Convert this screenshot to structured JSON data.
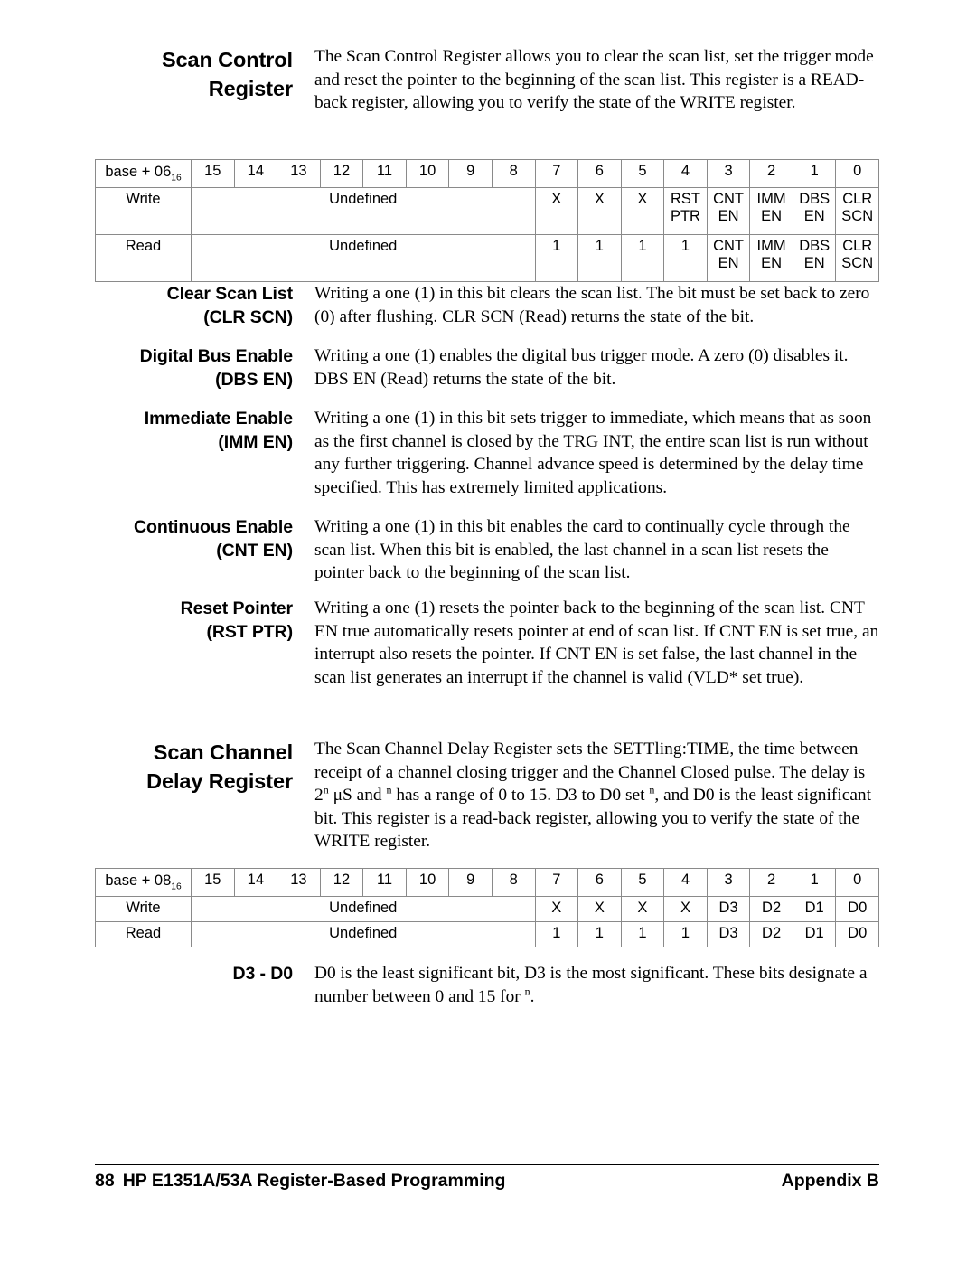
{
  "sections": [
    {
      "id": "scan-control-register",
      "heading_lines": [
        "Scan Control",
        "Register"
      ],
      "body": "The Scan Control Register allows you to clear the scan list, set the trigger mode and reset the pointer to the beginning of the scan list.  This register is a READ-back register, allowing you to verify the state of the WRITE register."
    },
    {
      "id": "clear-scan-list",
      "heading_lines": [
        "Clear Scan List",
        "(CLR SCN)"
      ],
      "body": "Writing a one (1) in this bit clears the scan list.  The bit must be set back to zero (0) after flushing.  CLR SCN (Read) returns the state of the bit."
    },
    {
      "id": "digital-bus-enable",
      "heading_lines": [
        "Digital Bus Enable",
        "(DBS EN)"
      ],
      "body": "Writing a one (1) enables the digital bus trigger mode.  A zero (0) disables it.  DBS EN (Read) returns the state of the bit."
    },
    {
      "id": "immediate-enable",
      "heading_lines": [
        "Immediate Enable",
        "(IMM EN)"
      ],
      "body": "Writing a one (1) in this bit sets trigger to immediate, which means that as soon as the first channel is closed by the TRG INT, the entire scan list is run without any further triggering.  Channel advance speed is determined by the delay time specified.  This has extremely limited applications."
    },
    {
      "id": "continuous-enable",
      "heading_lines": [
        "Continuous Enable",
        "(CNT EN)"
      ],
      "body": "Writing a one (1) in this bit enables the card to continually cycle through the scan list.  When this bit is enabled, the last channel in a scan list resets the pointer back to the beginning of the scan list."
    },
    {
      "id": "reset-pointer",
      "heading_lines": [
        "Reset Pointer",
        "(RST PTR)"
      ],
      "body": "Writing a one (1) resets the pointer back to the beginning of the scan list.  CNT EN true automatically resets pointer at end of scan list.  If CNT EN is set true, an interrupt also resets the pointer.  If CNT EN is set false, the last channel in the scan list generates an interrupt if the channel is valid (VLD* set true)."
    },
    {
      "id": "scan-channel-delay-register",
      "heading_lines": [
        "Scan Channel",
        "Delay Register"
      ],
      "body_html": "The Scan Channel Delay Register sets the SETTling:TIME, the time between receipt of a channel closing trigger and the Channel Closed pulse.  The delay is 2<sup>n</sup> μS and <sup>n</sup> has a range of 0 to 15.  D3 to D0 set <sup>n</sup>, and D0 is the least significant bit.  This register is a read-back register, allowing you to verify the state of the WRITE register."
    },
    {
      "id": "d3-d0",
      "heading_lines": [
        "D3 - D0"
      ],
      "body_html": "D0 is the least significant bit, D3 is the most significant.  These bits designate a number between 0 and 15 for <sup>n</sup>."
    }
  ],
  "tables": [
    {
      "id": "scan-control-register-table",
      "address_label_html": "base + 06<sub>16</sub>",
      "bit_headers": [
        "15",
        "14",
        "13",
        "12",
        "11",
        "10",
        "9",
        "8",
        "7",
        "6",
        "5",
        "4",
        "3",
        "2",
        "1",
        "0"
      ],
      "rows": [
        {
          "label": "Write",
          "undefined_label": "Undefined",
          "cells": [
            "X",
            "X",
            "X",
            "RST\nPTR",
            "CNT\nEN",
            "IMM\nEN",
            "DBS\nEN",
            "CLR\nSCN"
          ]
        },
        {
          "label": "Read",
          "undefined_label": "Undefined",
          "cells": [
            "1",
            "1",
            "1",
            "1",
            "CNT\nEN",
            "IMM\nEN",
            "DBS\nEN",
            "CLR\nSCN"
          ]
        }
      ]
    },
    {
      "id": "scan-channel-delay-register-table",
      "address_label_html": "base + 08<sub>16</sub>",
      "bit_headers": [
        "15",
        "14",
        "13",
        "12",
        "11",
        "10",
        "9",
        "8",
        "7",
        "6",
        "5",
        "4",
        "3",
        "2",
        "1",
        "0"
      ],
      "rows": [
        {
          "label": "Write",
          "undefined_label": "Undefined",
          "cells": [
            "X",
            "X",
            "X",
            "X",
            "D3",
            "D2",
            "D1",
            "D0"
          ]
        },
        {
          "label": "Read",
          "undefined_label": "Undefined",
          "cells": [
            "1",
            "1",
            "1",
            "1",
            "D3",
            "D2",
            "D1",
            "D0"
          ]
        }
      ]
    }
  ],
  "footer": {
    "page_number": "88",
    "title": "HP E1351A/53A Register-Based Programming",
    "appendix": "Appendix B"
  }
}
